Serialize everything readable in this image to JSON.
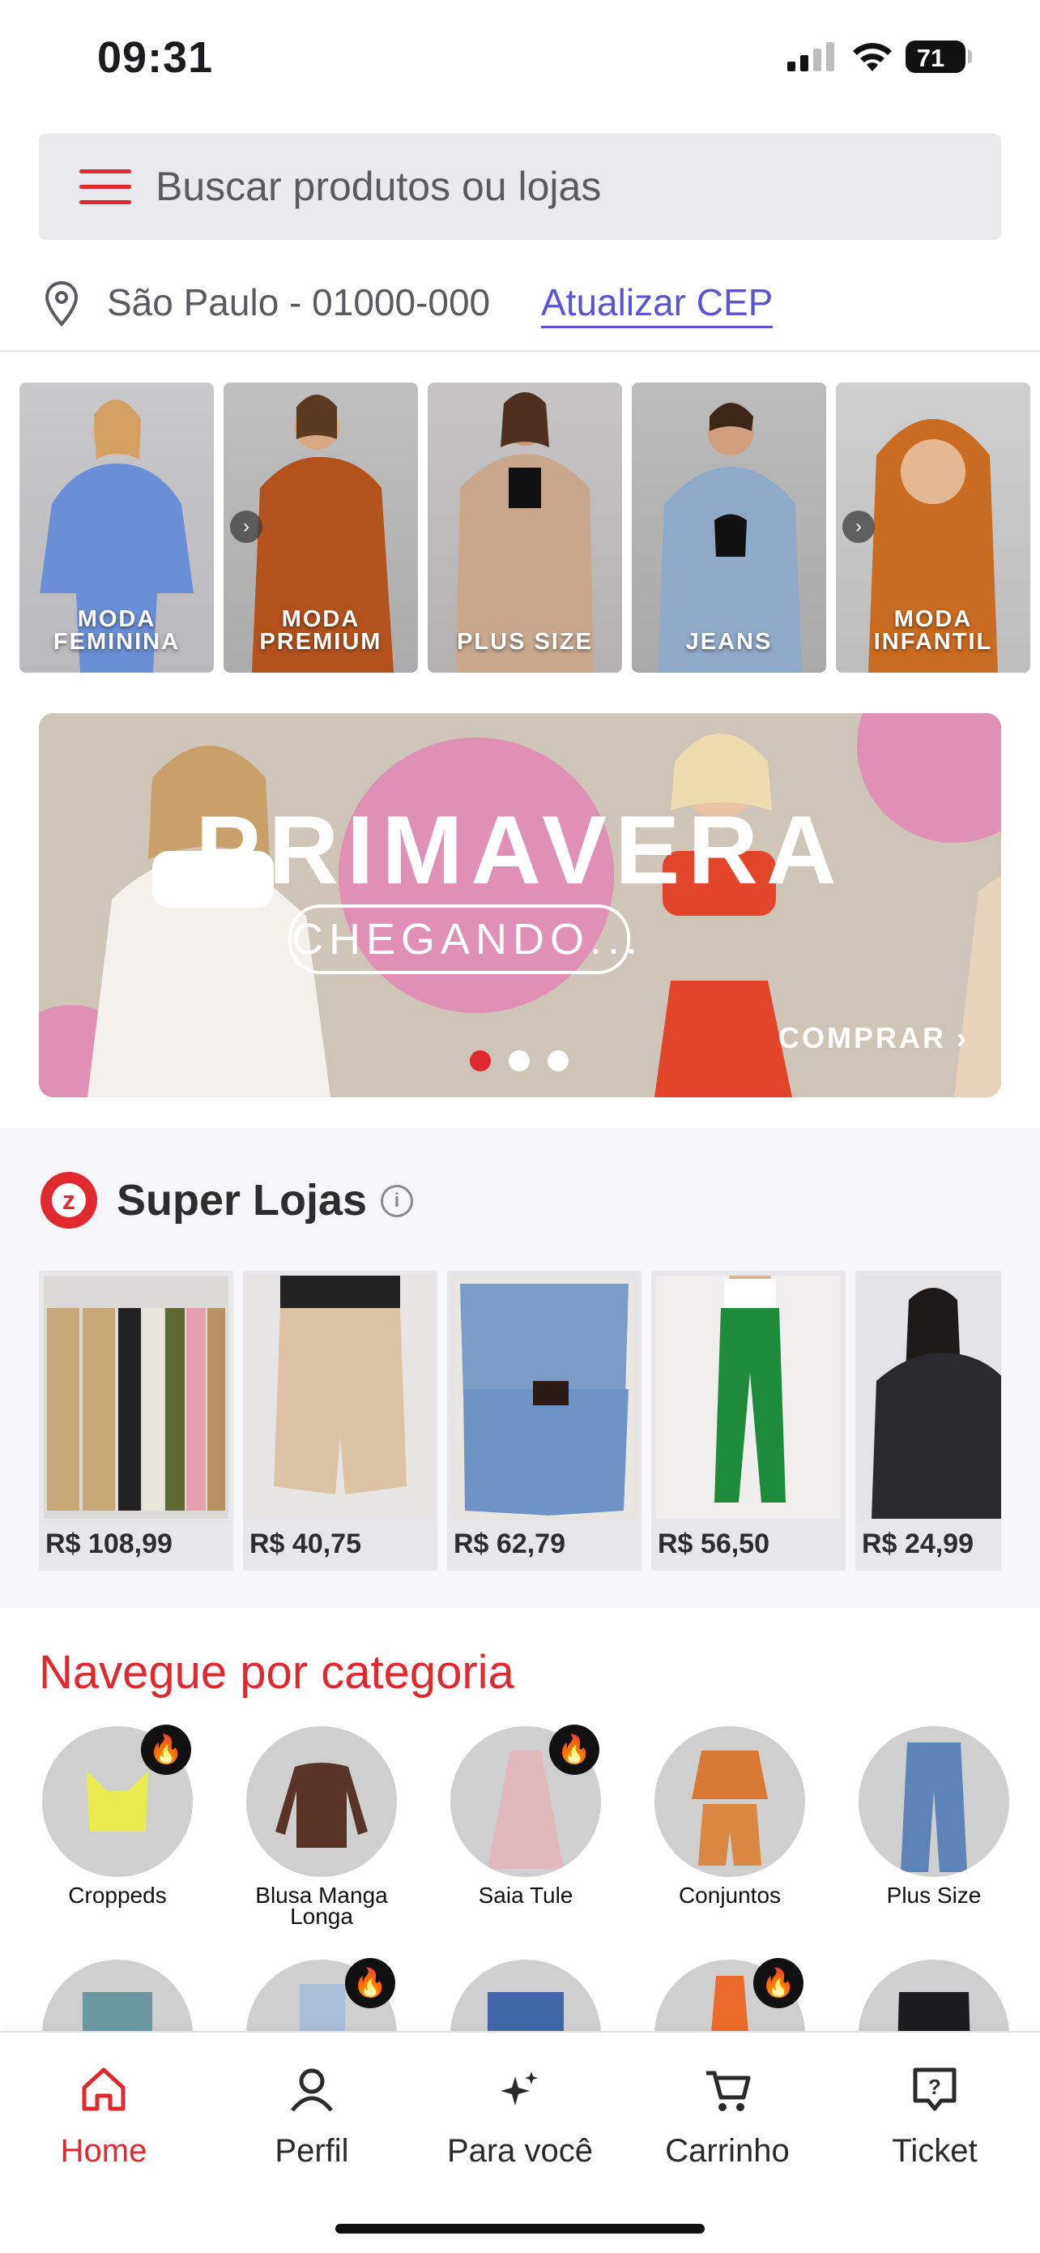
{
  "status": {
    "time": "09:31",
    "battery": "71"
  },
  "search": {
    "placeholder": "Buscar produtos ou lojas"
  },
  "location": {
    "city": "São Paulo - 01000-000",
    "update_link": "Atualizar CEP"
  },
  "category_tiles": [
    {
      "label1": "MODA",
      "label2": "FEMININA"
    },
    {
      "label1": "MODA",
      "label2": "PREMIUM"
    },
    {
      "label1": "PLUS SIZE",
      "label2": ""
    },
    {
      "label1": "JEANS",
      "label2": ""
    },
    {
      "label1": "MODA",
      "label2": "INFANTIL"
    }
  ],
  "banner": {
    "headline": "PRIMAVERA",
    "sub": "CHEGANDO...",
    "cta": "COMPRAR ›"
  },
  "super_lojas": {
    "title": "Super Lojas",
    "products": [
      {
        "price": "R$ 108,99"
      },
      {
        "price": "R$ 40,75"
      },
      {
        "price": "R$ 62,79"
      },
      {
        "price": "R$ 56,50"
      },
      {
        "price": "R$ 24,99"
      }
    ]
  },
  "categories": {
    "title": "Navegue por categoria",
    "items": [
      {
        "name": "Croppeds",
        "hot": true
      },
      {
        "name": "Blusa Manga\nLonga",
        "hot": false
      },
      {
        "name": "Saia Tule",
        "hot": true
      },
      {
        "name": "Conjuntos",
        "hot": false
      },
      {
        "name": "Plus Size",
        "hot": false
      }
    ]
  },
  "nav": {
    "home": "Home",
    "perfil": "Perfil",
    "para_voce": "Para você",
    "carrinho": "Carrinho",
    "ticket": "Ticket"
  },
  "colors": {
    "accent": "#e0282f",
    "link": "#5b55d6"
  }
}
